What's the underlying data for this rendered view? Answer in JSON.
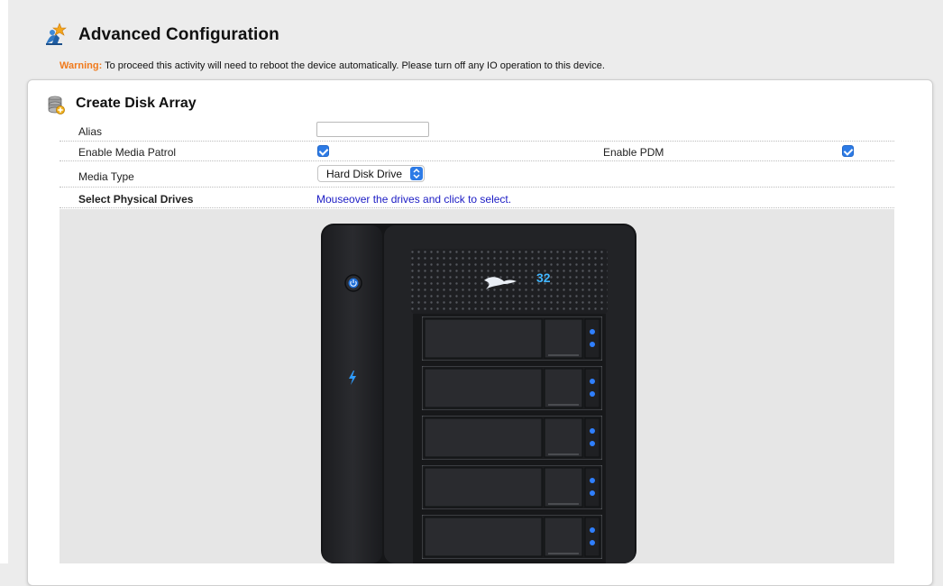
{
  "header": {
    "title": "Advanced Configuration",
    "warning_label": "Warning:",
    "warning_text": " To proceed this activity will need to reboot the device automatically. Please turn off any IO operation to this device."
  },
  "section": {
    "title": "Create Disk Array"
  },
  "form": {
    "alias_label": "Alias",
    "alias_value": "",
    "media_patrol_label": "Enable Media Patrol",
    "media_patrol_checked": true,
    "pdm_label": "Enable PDM",
    "pdm_checked": true,
    "media_type_label": "Media Type",
    "media_type_value": "Hard Disk Drive",
    "select_drives_label": "Select Physical Drives",
    "select_drives_hint": "Mouseover the drives and click to select."
  },
  "device": {
    "logo_text": "32",
    "bay_count": 5
  },
  "colors": {
    "warning": "#f07a1c",
    "checkbox": "#2d7be6",
    "hint_link": "#1b1bc4",
    "led": "#2f7fff"
  }
}
